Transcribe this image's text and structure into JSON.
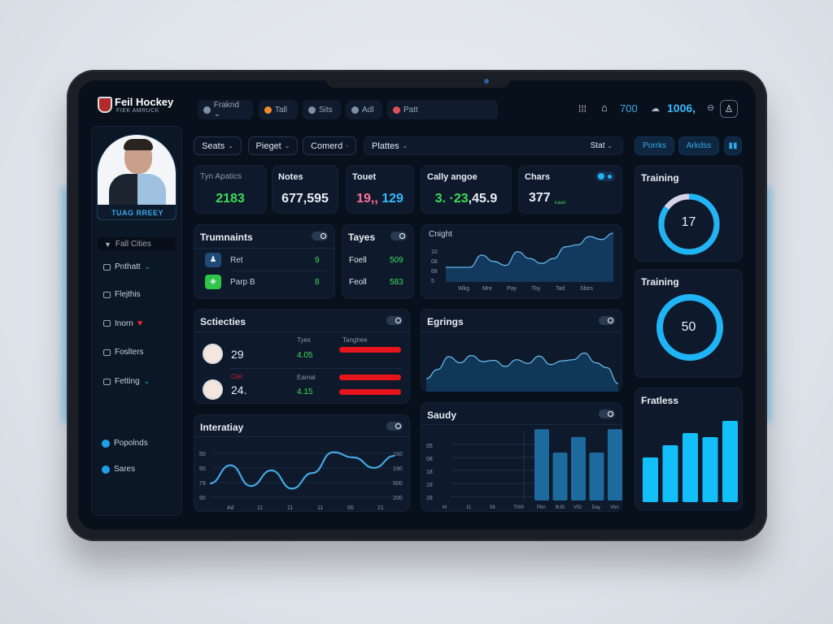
{
  "app": {
    "logo_title": "Feil Hockey",
    "logo_subtitle": "FIEK AMRUCK"
  },
  "top_pills": [
    {
      "label": "Fraknd ⌄",
      "dot": "#7f8fa5"
    },
    {
      "label": "Tall",
      "dot": "#f08a2a"
    },
    {
      "label": "Sits",
      "dot": "#7f8fa5"
    },
    {
      "label": "Adl",
      "dot": "#7f8fa5"
    },
    {
      "label": "Patt",
      "dot": "#e2505a"
    }
  ],
  "top_right": {
    "value1": "700",
    "value2": "1006,"
  },
  "profile": {
    "name": "TUAG RREEY"
  },
  "sidebar": {
    "items": [
      {
        "label": "Fall Cities",
        "active": true
      },
      {
        "label": "Pnthatt",
        "chevron": true
      },
      {
        "label": "Flejthis"
      },
      {
        "label": "Inorn",
        "heart": true
      },
      {
        "label": "Foslters"
      },
      {
        "label": "Fetting",
        "chevron": true
      }
    ],
    "bottom_items": [
      {
        "label": "Popolnds"
      },
      {
        "label": "Sares"
      }
    ]
  },
  "filters": {
    "seats": "Seats",
    "pieget": "Pieget",
    "comerd": "Comerd",
    "plattes": "Plattes",
    "stat": "Stat",
    "porrks": "Porrks",
    "arkdss": "Arkdss"
  },
  "stats": [
    {
      "label": "Tyn Apatics",
      "value": "2183",
      "color": "#3ddc5a"
    },
    {
      "label": "Notes",
      "value": "677,595",
      "color": "#ffffff"
    },
    {
      "label": "Touet",
      "value_a": "19,,",
      "value_b": "129",
      "color_a": "#ff6f9a",
      "color_b": "#35b8ff"
    },
    {
      "label": "Cally angoe",
      "value_a": "3.  ·23",
      "value_b": ",45.9",
      "color_a": "#3ddc5a",
      "color_b": "#ffffff"
    },
    {
      "label": "Chars",
      "value": "377",
      "sub": "∧auo",
      "color": "#ffffff"
    }
  ],
  "tournaments": {
    "title": "Trumnaints",
    "rows": [
      {
        "name": "Ret",
        "value": "9",
        "icon_color": "#1f4a78"
      },
      {
        "name": "Parp B",
        "value": "8",
        "icon_color": "#2fc54a"
      }
    ]
  },
  "tayes": {
    "title": "Tayes",
    "rows": [
      {
        "name": "Foell",
        "value": "509"
      },
      {
        "name": "Feoll",
        "value": "583"
      }
    ]
  },
  "selections": {
    "title": "Sctiecties",
    "col1": "Tyes",
    "col2": "Tanghee",
    "rows": [
      {
        "value": "29",
        "tag": "",
        "sub_label": "",
        "score": "4.05",
        "bar": 0.95
      },
      {
        "value": "24.",
        "tag": "Ciet",
        "sub_label": "Eamal",
        "score": "4.15",
        "bar": 0.95,
        "bar2": 0.95
      }
    ]
  },
  "training1": {
    "title": "Training",
    "value": "17",
    "progress": 0.85
  },
  "training2": {
    "title": "Training",
    "value": "50",
    "progress": 1.0
  },
  "accent": "#1fb4f5",
  "chart_data": [
    {
      "type": "area",
      "title": "Cnight",
      "yticks": [
        "10",
        "08",
        "68",
        "5"
      ],
      "categories": [
        "Wkg",
        "Mnr",
        "Pay",
        "Tky",
        "Tad",
        "Sbes"
      ],
      "values": [
        3,
        3,
        3,
        5.5,
        4.2,
        3.4,
        6.2,
        4.8,
        3.8,
        4.8,
        7.2,
        7.6,
        9.3,
        8.7,
        10
      ]
    },
    {
      "type": "area",
      "title": "Egrings",
      "values": [
        2,
        3.5,
        5.6,
        4.6,
        5.8,
        4.8,
        5,
        4,
        5.1,
        4.5,
        5.7,
        4.3,
        4.9,
        5.1,
        6.2,
        4.6,
        3.8,
        1.2
      ]
    },
    {
      "type": "line",
      "title": "Interatiay",
      "yticks_left": [
        "50",
        "60",
        "79",
        "90"
      ],
      "yticks_right": [
        "160",
        "190",
        "500",
        "200"
      ],
      "xticks": [
        "Ad",
        "11",
        "11",
        "11",
        "00",
        "21"
      ],
      "values": [
        2.5,
        6,
        2,
        5,
        1.5,
        4.5,
        8.5,
        7.5,
        5.5,
        7.8
      ]
    },
    {
      "type": "bar",
      "title": "Saudy",
      "yticks": [
        "05",
        "08",
        "18",
        "18",
        "28"
      ],
      "xticks": [
        "M",
        "11",
        "58",
        "7000",
        "Pbn",
        "9UD",
        "VID",
        "Day",
        "Vbn"
      ],
      "values": [
        6.4,
        4.3,
        5.7,
        4.3,
        6.4
      ]
    },
    {
      "type": "bar",
      "title": "Fratless",
      "values": [
        55,
        70,
        85,
        80,
        100
      ]
    }
  ]
}
